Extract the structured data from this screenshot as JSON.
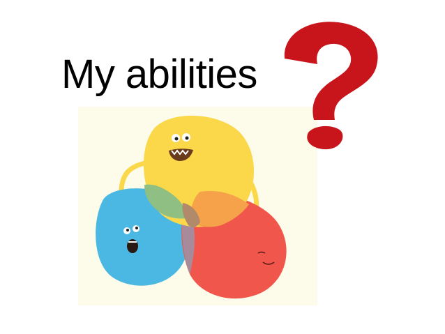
{
  "slide": {
    "title": "My abilities"
  },
  "illustration": {
    "background_color": "#fdfbea",
    "circles": [
      {
        "name": "yellow-character",
        "color": "#fbd84a"
      },
      {
        "name": "blue-character",
        "color": "#4ab8e2"
      },
      {
        "name": "red-character",
        "color": "#f0564b"
      }
    ]
  },
  "question_mark": {
    "color": "#c8151b"
  }
}
